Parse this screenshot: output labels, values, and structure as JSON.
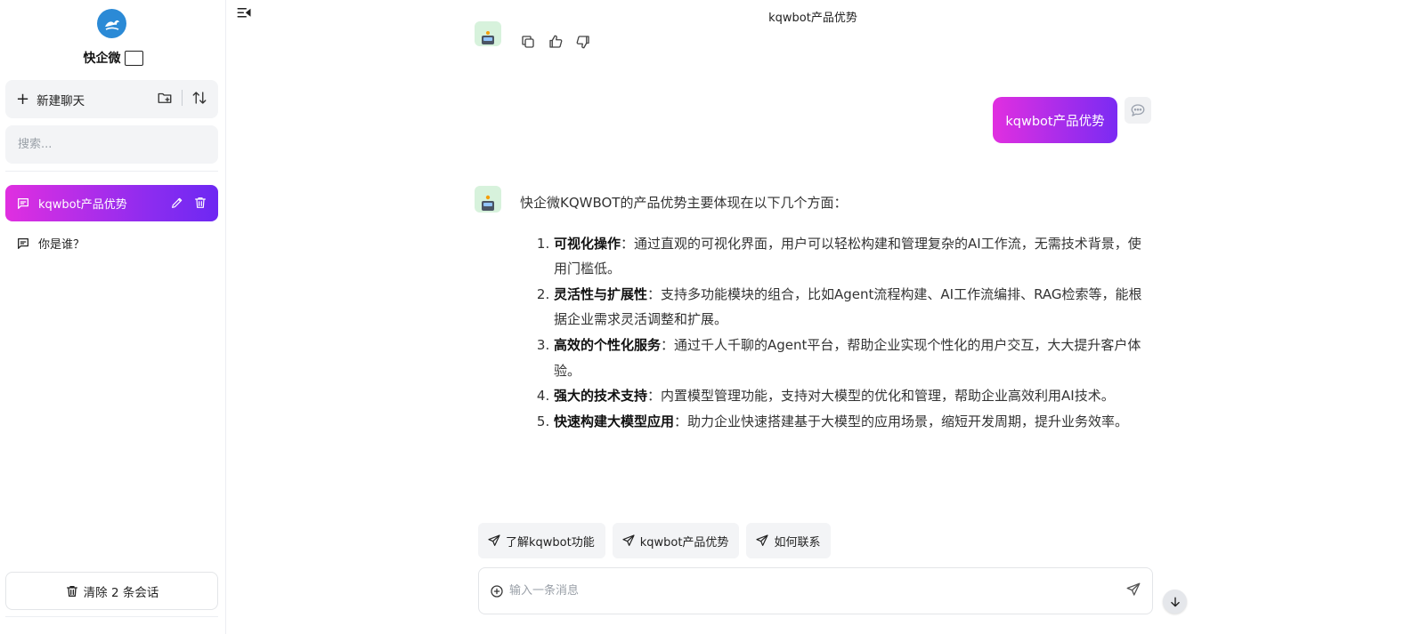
{
  "sidebar": {
    "brand": "快企微",
    "new_chat_label": "新建聊天",
    "search_placeholder": "搜索...",
    "conversations": [
      {
        "title": "kqwbot产品优势",
        "active": true
      },
      {
        "title": "你是谁？",
        "active": false
      }
    ],
    "clear_label": "清除 2 条会话"
  },
  "header": {
    "title": "kqwbot产品优势"
  },
  "chat": {
    "user_message": "kqwbot产品优势",
    "answer_intro": "快企微KQWBOT的产品优势主要体现在以下几个方面：",
    "answer_items": [
      {
        "title": "可视化操作",
        "text": "：通过直观的可视化界面，用户可以轻松构建和管理复杂的AI工作流，无需技术背景，使用门槛低。"
      },
      {
        "title": "灵活性与扩展性",
        "text": "：支持多功能模块的组合，比如Agent流程构建、AI工作流编排、RAG检索等，能根据企业需求灵活调整和扩展。"
      },
      {
        "title": "高效的个性化服务",
        "text": "：通过千人千聊的Agent平台，帮助企业实现个性化的用户交互，大大提升客户体验。"
      },
      {
        "title": "强大的技术支持",
        "text": "：内置模型管理功能，支持对大模型的优化和管理，帮助企业高效利用AI技术。"
      },
      {
        "title": "快速构建大模型应用",
        "text": "：助力企业快速搭建基于大模型的应用场景，缩短开发周期，提升业务效率。"
      }
    ]
  },
  "suggestions": [
    "了解kqwbot功能",
    "kqwbot产品优势",
    "如何联系"
  ],
  "composer": {
    "placeholder": "输入一条消息",
    "value": ""
  },
  "colors": {
    "accent_start": "#e12fe0",
    "accent_end": "#7a2bf3",
    "logo": "#2b8ad6",
    "bot_avatar_bg": "#d7f2dc"
  }
}
